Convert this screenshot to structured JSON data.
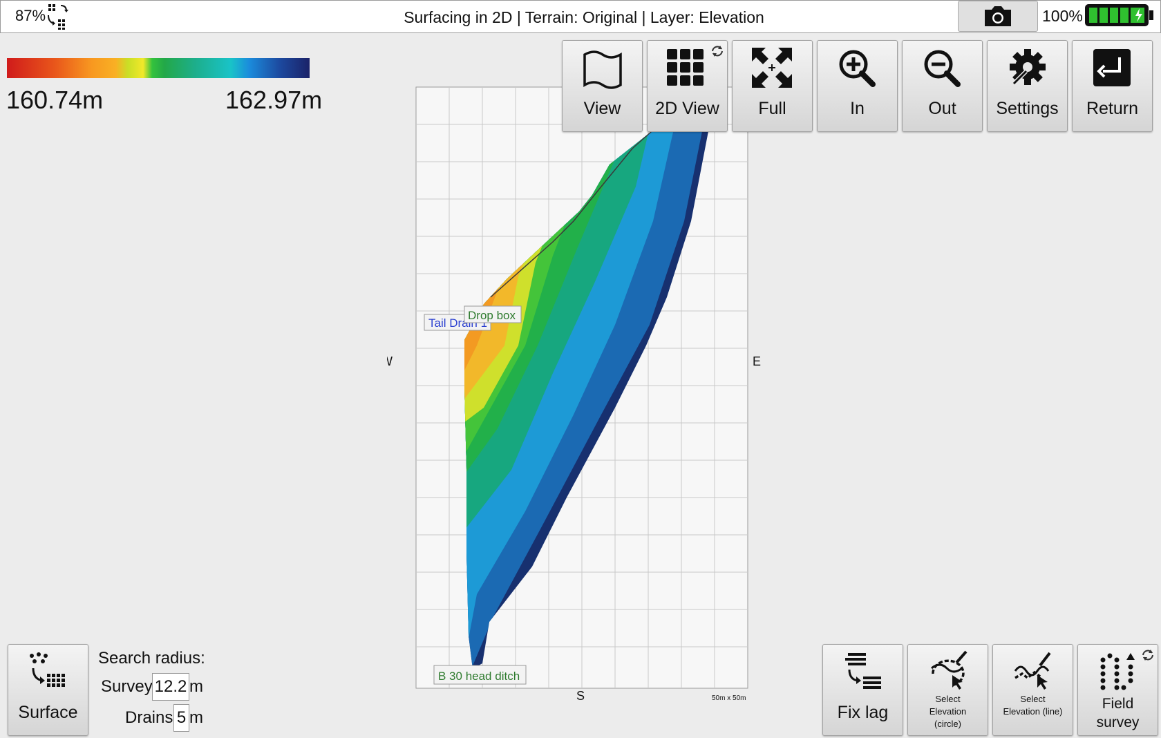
{
  "status": {
    "signal_pct": "87%",
    "title": "Surfacing in 2D | Terrain: Original | Layer: Elevation",
    "battery_pct": "100%"
  },
  "legend": {
    "min": "160.74m",
    "max": "162.97m"
  },
  "toolbar": [
    {
      "label": "View",
      "icon": "map-icon"
    },
    {
      "label": "2D View",
      "icon": "grid-icon"
    },
    {
      "label": "Full",
      "icon": "expand-icon"
    },
    {
      "label": "In",
      "icon": "zoom-in-icon"
    },
    {
      "label": "Out",
      "icon": "zoom-out-icon"
    },
    {
      "label": "Settings",
      "icon": "gear-icon"
    },
    {
      "label": "Return",
      "icon": "return-icon"
    }
  ],
  "map": {
    "compass": {
      "n": "",
      "w": "W",
      "e": "E",
      "s": "S"
    },
    "labels": {
      "tail_drain": "Tail Drain 1",
      "drop_box": "Drop box",
      "head_ditch": "B 30 head ditch"
    },
    "scale": "50m x 50m"
  },
  "bottom_left": {
    "surface_label": "Surface",
    "search_radius": "Search radius:",
    "survey_label": "Survey",
    "survey_value": "12.2",
    "drains_label": "Drains",
    "drains_value": "5",
    "unit": "m"
  },
  "bottom_right": [
    {
      "label": "Fix lag",
      "icon": "fix-lag-icon"
    },
    {
      "label": "Select Elevation (circle)",
      "icon": "select-circle-icon"
    },
    {
      "label": "Select Elevation (line)",
      "icon": "select-line-icon"
    },
    {
      "label": "Field survey",
      "icon": "field-survey-icon"
    }
  ],
  "colors": {
    "legend_low": "#d01b1b",
    "legend_high": "#1b2268",
    "battery": "#22b222"
  }
}
